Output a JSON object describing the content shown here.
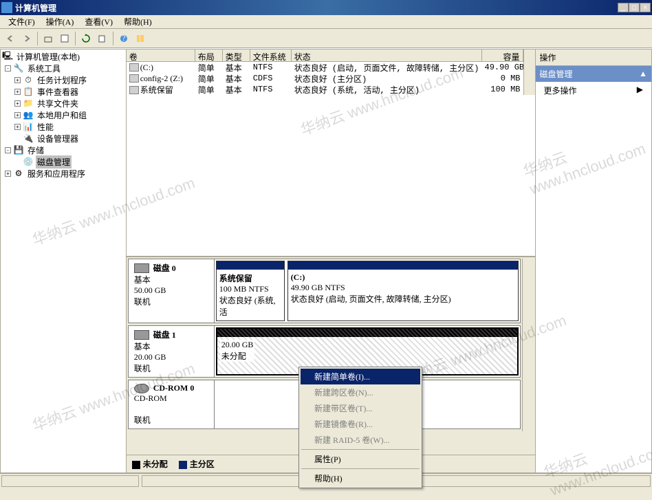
{
  "titlebar": {
    "title": "计算机管理"
  },
  "menu": {
    "file": "文件(F)",
    "action": "操作(A)",
    "view": "查看(V)",
    "help": "帮助(H)"
  },
  "tree": {
    "root": "计算机管理(本地)",
    "system_tools": "系统工具",
    "task_scheduler": "任务计划程序",
    "event_viewer": "事件查看器",
    "shared_folders": "共享文件夹",
    "local_users": "本地用户和组",
    "performance": "性能",
    "device_manager": "设备管理器",
    "storage": "存储",
    "disk_management": "磁盘管理",
    "services": "服务和应用程序"
  },
  "vol_headers": {
    "volume": "卷",
    "layout": "布局",
    "type": "类型",
    "fs": "文件系统",
    "status": "状态",
    "capacity": "容量"
  },
  "volumes": [
    {
      "name": "(C:)",
      "layout": "简单",
      "type": "基本",
      "fs": "NTFS",
      "status": "状态良好 (启动, 页面文件, 故障转储, 主分区)",
      "capacity": "49.90 GB"
    },
    {
      "name": "config-2 (Z:)",
      "layout": "简单",
      "type": "基本",
      "fs": "CDFS",
      "status": "状态良好 (主分区)",
      "capacity": "0 MB"
    },
    {
      "name": "系统保留",
      "layout": "简单",
      "type": "基本",
      "fs": "NTFS",
      "status": "状态良好 (系统, 活动, 主分区)",
      "capacity": "100 MB"
    }
  ],
  "disks": {
    "disk0": {
      "label": "磁盘 0",
      "type": "基本",
      "size": "50.00 GB",
      "status": "联机"
    },
    "disk0_part1": {
      "name": "系统保留",
      "size": "100 MB NTFS",
      "status": "状态良好 (系统, 活"
    },
    "disk0_part2": {
      "name": "(C:)",
      "size": "49.90 GB NTFS",
      "status": "状态良好 (启动, 页面文件, 故障转储, 主分区)"
    },
    "disk1": {
      "label": "磁盘 1",
      "type": "基本",
      "size": "20.00 GB",
      "status": "联机"
    },
    "disk1_part1": {
      "size": "20.00 GB",
      "status": "未分配"
    },
    "cdrom": {
      "label": "CD-ROM 0",
      "type": "CD-ROM",
      "status": "联机"
    }
  },
  "legend": {
    "unallocated": "未分配",
    "primary": "主分区"
  },
  "actions": {
    "header": "操作",
    "section": "磁盘管理",
    "more": "更多操作"
  },
  "context_menu": {
    "simple": "新建简单卷(I)...",
    "spanned": "新建跨区卷(N)...",
    "striped": "新建带区卷(T)...",
    "mirrored": "新建镜像卷(R)...",
    "raid5": "新建 RAID-5 卷(W)...",
    "properties": "属性(P)",
    "help": "帮助(H)"
  },
  "watermark": "华纳云 www.hncloud.com"
}
